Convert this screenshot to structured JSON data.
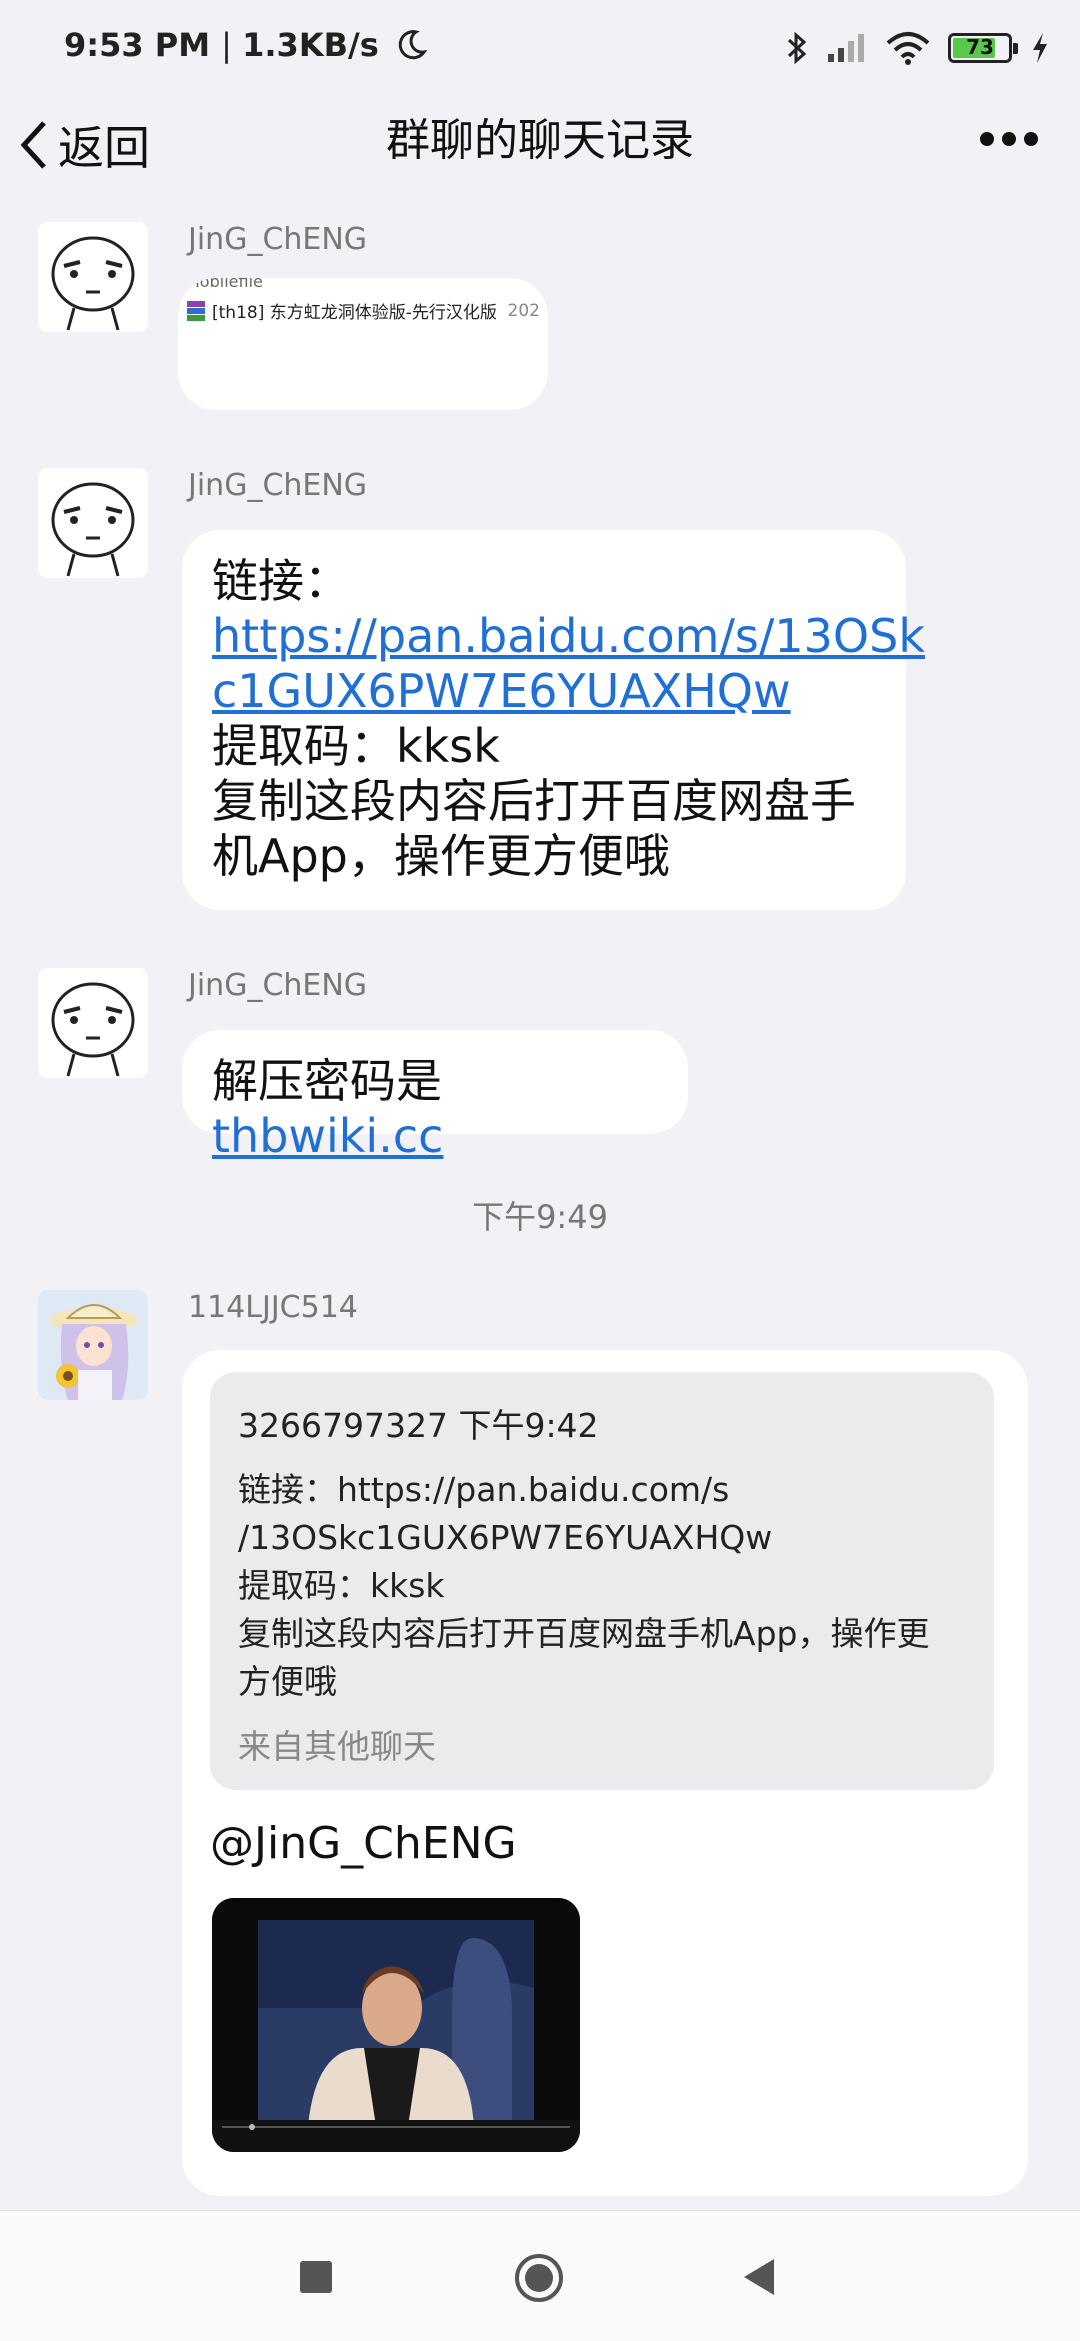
{
  "status_bar": {
    "time": "9:53 PM",
    "speed": "1.3KB/s",
    "battery": "73"
  },
  "header": {
    "back_label": "返回",
    "title": "群聊的聊天记录"
  },
  "messages": [
    {
      "sender": "JinG_ChENG",
      "file_row_name": "[th18] 东方虹龙洞体验版-先行汉化版",
      "file_row_top": "Mobilefile",
      "file_row_date": "202"
    },
    {
      "sender": "JinG_ChENG",
      "link_label": "链接：",
      "link_url_line1": "https://pan.baidu.com/s/13OSk",
      "link_url_line2": "c1GUX6PW7E6YUAXHQw",
      "code_line": "提取码：kksk",
      "tip_line1": "复制这段内容后打开百度网盘手",
      "tip_line2": "机App，操作更方便哦"
    },
    {
      "sender": "JinG_ChENG",
      "text_prefix": "解压密码是",
      "text_link": "thbwiki.cc"
    }
  ],
  "timestamp": "下午9:49",
  "message4": {
    "sender": "114LJJC514",
    "forward_header": "3266797327 下午9:42",
    "forward_line1": "链接：https://pan.baidu.com/s",
    "forward_line2": "/13OSkc1GUX6PW7E6YUAXHQw",
    "forward_line3": "提取码：kksk",
    "forward_line4": "复制这段内容后打开百度网盘手机App，操作更",
    "forward_line5": "方便哦",
    "forward_source": "来自其他聊天",
    "mention": "@JinG_ChENG"
  }
}
